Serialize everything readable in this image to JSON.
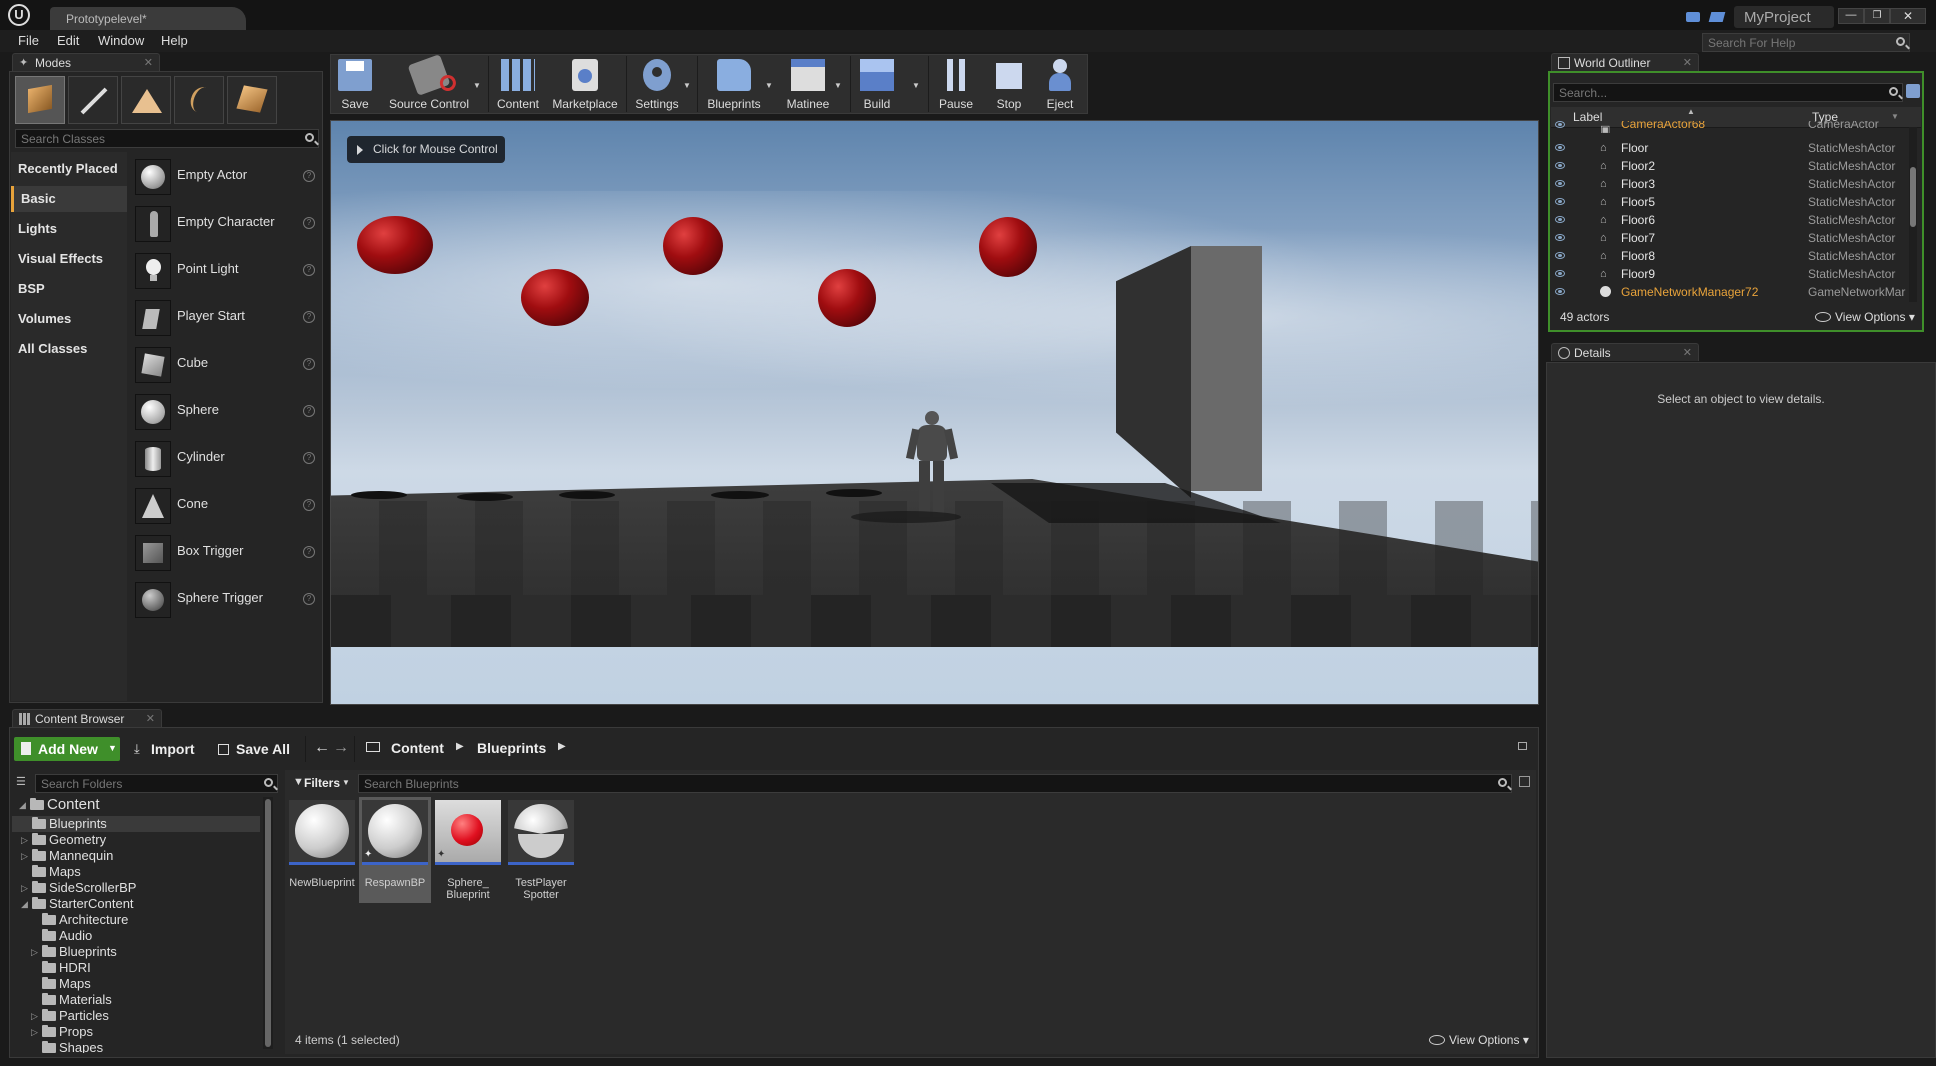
{
  "window": {
    "tab_title": "Prototypelevel*",
    "project_name": "MyProject",
    "search_help_placeholder": "Search For Help"
  },
  "menu": {
    "items": [
      "File",
      "Edit",
      "Window",
      "Help"
    ]
  },
  "modes": {
    "tab_label": "Modes",
    "search_placeholder": "Search Classes",
    "categories": [
      "Recently Placed",
      "Basic",
      "Lights",
      "Visual Effects",
      "BSP",
      "Volumes",
      "All Classes"
    ],
    "selected_category": "Basic",
    "items": [
      "Empty Actor",
      "Empty Character",
      "Point Light",
      "Player Start",
      "Cube",
      "Sphere",
      "Cylinder",
      "Cone",
      "Box Trigger",
      "Sphere Trigger"
    ]
  },
  "toolbar": {
    "buttons": [
      "Save",
      "Source Control",
      "Content",
      "Marketplace",
      "Settings",
      "Blueprints",
      "Matinee",
      "Build",
      "Pause",
      "Stop",
      "Eject"
    ]
  },
  "viewport": {
    "mouse_control_label": "Click for Mouse Control"
  },
  "outliner": {
    "tab_label": "World Outliner",
    "search_placeholder": "Search...",
    "col_label": "Label",
    "col_type": "Type",
    "rows": [
      {
        "name": "CameraActor68",
        "type": "CameraActor"
      },
      {
        "name": "Floor",
        "type": "StaticMeshActor"
      },
      {
        "name": "Floor2",
        "type": "StaticMeshActor"
      },
      {
        "name": "Floor3",
        "type": "StaticMeshActor"
      },
      {
        "name": "Floor5",
        "type": "StaticMeshActor"
      },
      {
        "name": "Floor6",
        "type": "StaticMeshActor"
      },
      {
        "name": "Floor7",
        "type": "StaticMeshActor"
      },
      {
        "name": "Floor8",
        "type": "StaticMeshActor"
      },
      {
        "name": "Floor9",
        "type": "StaticMeshActor"
      },
      {
        "name": "GameNetworkManager72",
        "type": "GameNetworkMar"
      }
    ],
    "count": "49 actors",
    "view_options": "View Options"
  },
  "details": {
    "tab_label": "Details",
    "empty_message": "Select an object to view details."
  },
  "content_browser": {
    "tab_label": "Content Browser",
    "add_new": "Add New",
    "import": "Import",
    "save_all": "Save All",
    "breadcrumb": [
      "Content",
      "Blueprints"
    ],
    "search_folders_placeholder": "Search Folders",
    "filters": "Filters",
    "search_assets_placeholder": "Search Blueprints",
    "tree": [
      {
        "label": "Content"
      },
      {
        "label": "Blueprints"
      },
      {
        "label": "Geometry"
      },
      {
        "label": "Mannequin"
      },
      {
        "label": "Maps"
      },
      {
        "label": "SideScrollerBP"
      },
      {
        "label": "StarterContent"
      },
      {
        "label": "Architecture"
      },
      {
        "label": "Audio"
      },
      {
        "label": "Blueprints"
      },
      {
        "label": "HDRI"
      },
      {
        "label": "Maps"
      },
      {
        "label": "Materials"
      },
      {
        "label": "Particles"
      },
      {
        "label": "Props"
      },
      {
        "label": "Shapes"
      }
    ],
    "assets": [
      {
        "name": "NewBlueprint"
      },
      {
        "name": "RespawnBP"
      },
      {
        "name": "Sphere_ Blueprint"
      },
      {
        "name": "TestPlayer Spotter"
      }
    ],
    "status": "4 items (1 selected)",
    "view_options": "View Options"
  },
  "colors": {
    "accent_green": "#3f8f2a",
    "selection_orange": "#e8a33b",
    "asset_blue": "#3c64c8"
  }
}
